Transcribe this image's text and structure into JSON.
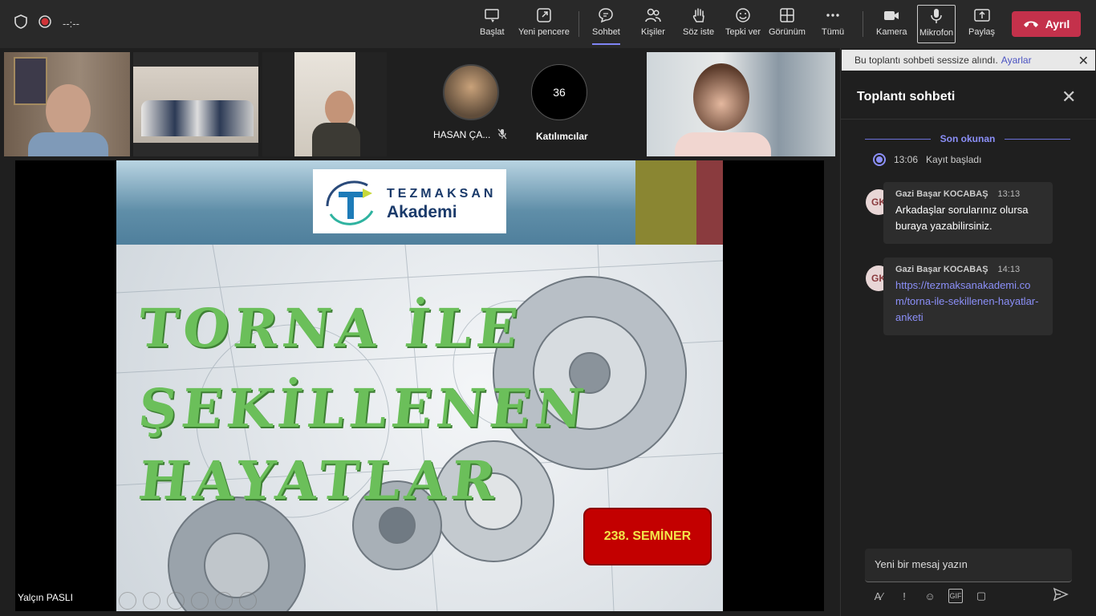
{
  "topbar": {
    "timer": "--:--",
    "buttons": {
      "start": "Başlat",
      "new_window": "Yeni pencere",
      "chat": "Sohbet",
      "people": "Kişiler",
      "raise_hand": "Söz iste",
      "react": "Tepki ver",
      "view": "Görünüm",
      "more": "Tümü",
      "camera": "Kamera",
      "mic": "Mikrofon",
      "share": "Paylaş",
      "leave": "Ayrıl"
    }
  },
  "participants": {
    "named_tile": "HASAN ÇA...",
    "count": "36",
    "count_label": "Katılımcılar"
  },
  "slide": {
    "logo_line1": "TEZMAKSAN",
    "logo_line2": "Akademi",
    "title_lines": [
      "TORNA İLE",
      "ŞEKİLLENEN",
      "HAYATLAR"
    ],
    "badge": "238. SEMİNER"
  },
  "presenter_name": "Yalçın PASLI",
  "chat": {
    "banner_text": "Bu toplantı sohbeti sessize alındı.",
    "banner_link": "Ayarlar",
    "title": "Toplantı sohbeti",
    "last_read": "Son okunan",
    "recording_time": "13:06",
    "recording_text": "Kayıt başladı",
    "messages": [
      {
        "initials": "GK",
        "sender": "Gazi Başar KOCABAŞ",
        "time": "13:13",
        "text": "Arkadaşlar sorularınız olursa buraya yazabilirsiniz."
      },
      {
        "initials": "GK",
        "sender": "Gazi Başar KOCABAŞ",
        "time": "14:13",
        "text": "https://tezmaksanakademi.com/torna-ile-sekillenen-hayatlar-anketi"
      }
    ],
    "compose_placeholder": "Yeni bir mesaj yazın"
  },
  "colors": {
    "accent": "#7f85f5",
    "leave": "#c4314b",
    "title_green": "#6bbf5a",
    "badge_red": "#c30000"
  }
}
